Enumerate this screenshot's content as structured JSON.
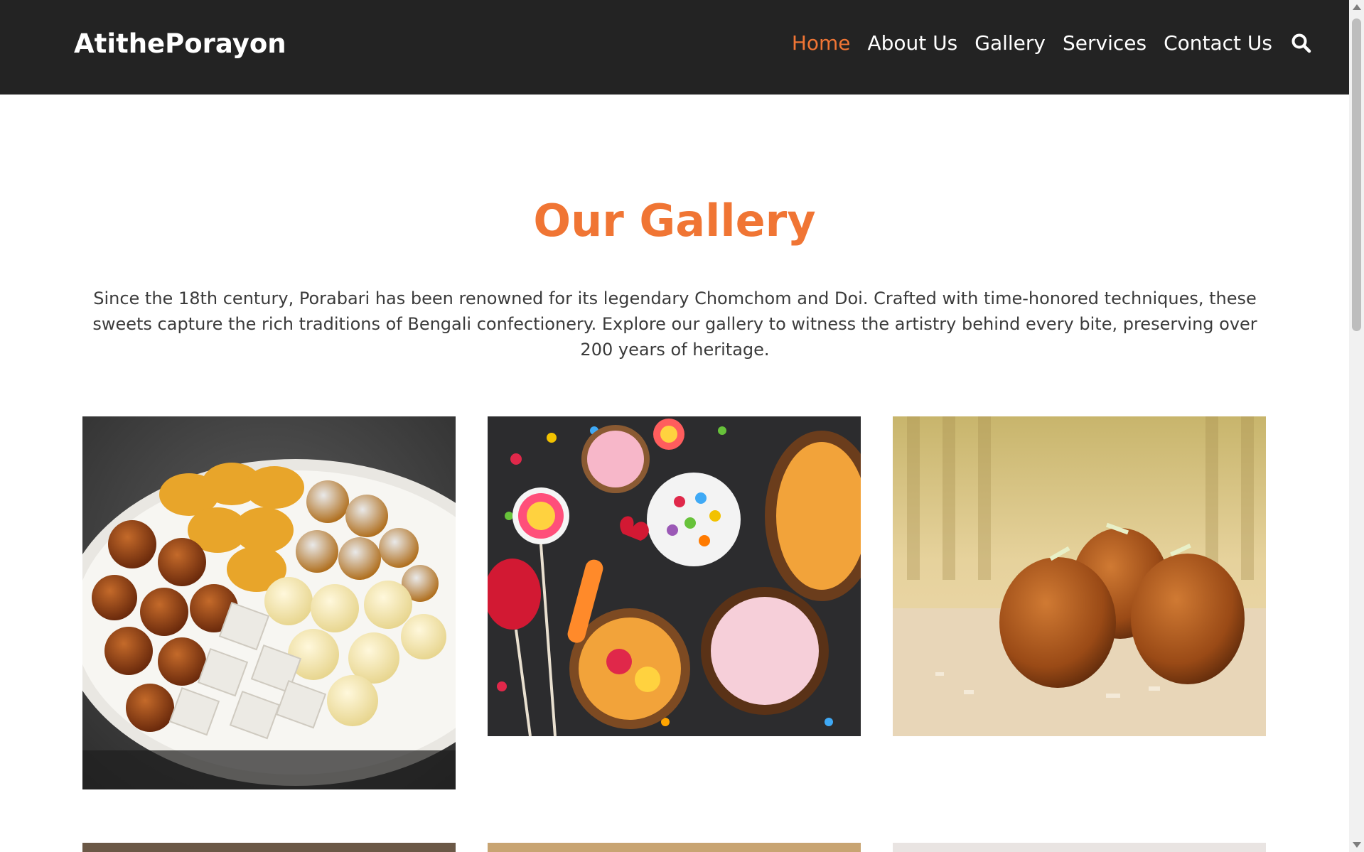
{
  "header": {
    "logo": "AtithePorayon",
    "nav": [
      {
        "label": "Home",
        "active": true
      },
      {
        "label": "About Us",
        "active": false
      },
      {
        "label": "Gallery",
        "active": false
      },
      {
        "label": "Services",
        "active": false
      },
      {
        "label": "Contact Us",
        "active": false
      }
    ],
    "search_icon": "search-icon"
  },
  "section": {
    "title": "Our Gallery",
    "intro": "Since the 18th century, Porabari has been renowned for its legendary Chomchom and Doi. Crafted with time-honored techniques, these sweets capture the rich traditions of Bengali confectionery. Explore our gallery to witness the artistry behind every bite, preserving over 200 years of heritage."
  },
  "gallery": {
    "images": [
      {
        "subject": "platter of mixed Indian sweets"
      },
      {
        "subject": "assorted candies and lollipops"
      },
      {
        "subject": "gulab jamun with nuts"
      },
      {
        "subject": "sweets (partially visible)"
      },
      {
        "subject": "sweets (partially visible)"
      },
      {
        "subject": "sweets (partially visible)"
      }
    ]
  },
  "colors": {
    "header_bg": "#232323",
    "accent": "#f07534",
    "text": "#3b3b3b"
  }
}
